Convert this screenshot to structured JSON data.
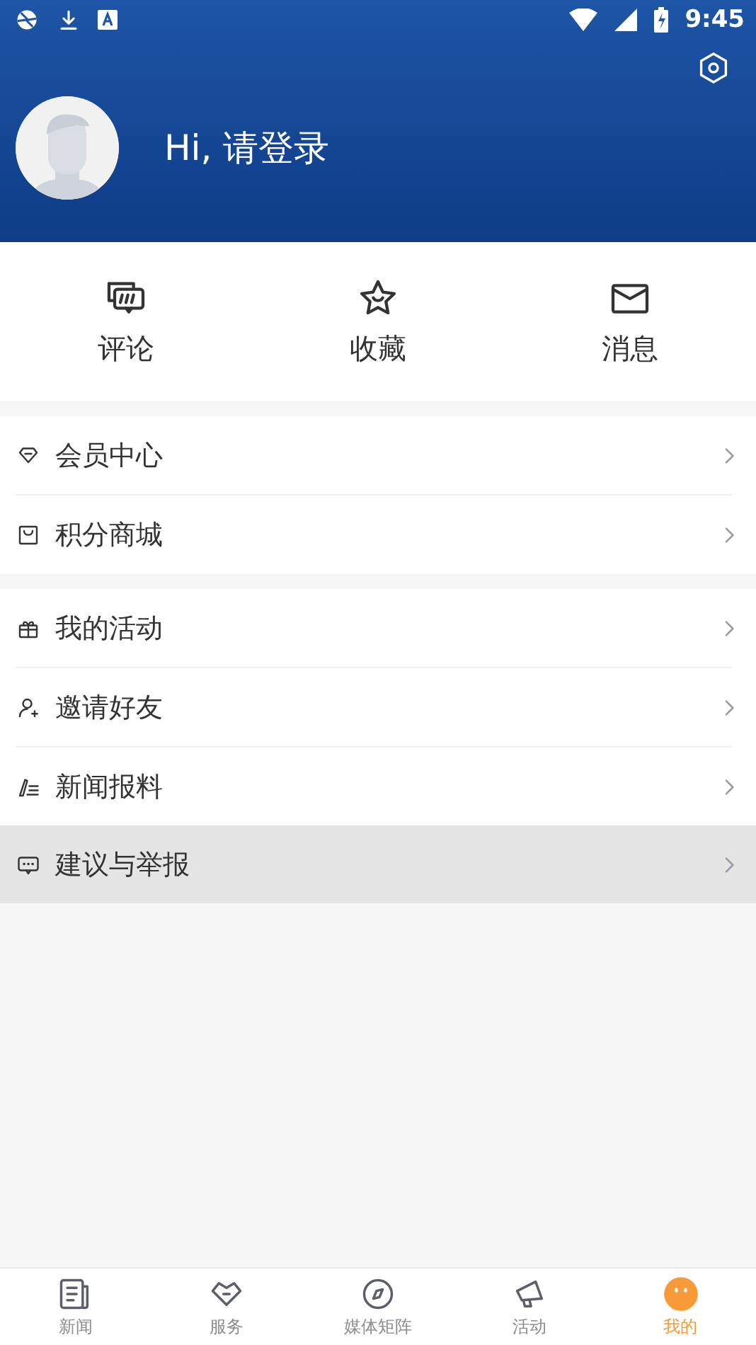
{
  "status_bar": {
    "time": "9:45"
  },
  "header": {
    "greeting": "Hi, 请登录"
  },
  "quick_actions": [
    {
      "label": "评论"
    },
    {
      "label": "收藏"
    },
    {
      "label": "消息"
    }
  ],
  "menu_groups": [
    {
      "items": [
        {
          "label": "会员中心",
          "selected": false
        },
        {
          "label": "积分商城",
          "selected": false
        }
      ]
    },
    {
      "items": [
        {
          "label": "我的活动",
          "selected": false
        },
        {
          "label": "邀请好友",
          "selected": false
        },
        {
          "label": "新闻报料",
          "selected": false
        },
        {
          "label": "建议与举报",
          "selected": true
        }
      ]
    }
  ],
  "tabs": [
    {
      "label": "新闻",
      "selected": false
    },
    {
      "label": "服务",
      "selected": false
    },
    {
      "label": "媒体矩阵",
      "selected": false
    },
    {
      "label": "活动",
      "selected": false
    },
    {
      "label": "我的",
      "selected": true
    }
  ]
}
